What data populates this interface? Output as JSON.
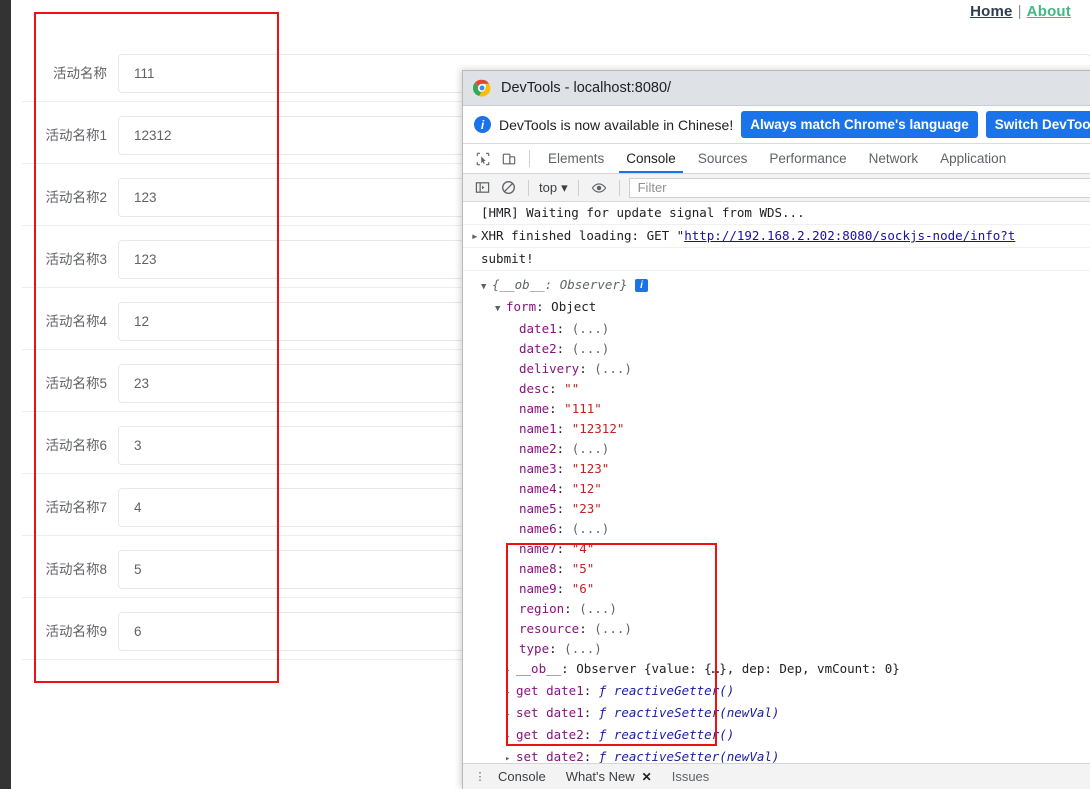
{
  "page": {
    "nav": {
      "home_label": "Home",
      "separator": "|",
      "about_label": "About"
    },
    "form": {
      "rows": [
        {
          "label": "活动名称",
          "value": "111"
        },
        {
          "label": "活动名称1",
          "value": "12312"
        },
        {
          "label": "活动名称2",
          "value": "123"
        },
        {
          "label": "活动名称3",
          "value": "123"
        },
        {
          "label": "活动名称4",
          "value": "12"
        },
        {
          "label": "活动名称5",
          "value": "23"
        },
        {
          "label": "活动名称6",
          "value": "3"
        },
        {
          "label": "活动名称7",
          "value": "4"
        },
        {
          "label": "活动名称8",
          "value": "5"
        },
        {
          "label": "活动名称9",
          "value": "6"
        }
      ]
    },
    "annotation_color": "#ee1111"
  },
  "devtools": {
    "titlebar": {
      "icon": "chrome-logo-icon",
      "title": "DevTools - localhost:8080/"
    },
    "banner": {
      "icon": "info-icon",
      "text": "DevTools is now available in Chinese!",
      "primary_button": "Always match Chrome's language",
      "secondary_button": "Switch DevToo"
    },
    "tabbar": {
      "inspect_icon": "inspect-element-icon",
      "device_icon": "device-toolbar-icon",
      "tabs": [
        {
          "label": "Elements",
          "active": false
        },
        {
          "label": "Console",
          "active": true
        },
        {
          "label": "Sources",
          "active": false
        },
        {
          "label": "Performance",
          "active": false
        },
        {
          "label": "Network",
          "active": false
        },
        {
          "label": "Application",
          "active": false
        }
      ]
    },
    "console_toolbar": {
      "sidebar_icon": "console-sidebar-icon",
      "clear_icon": "clear-console-icon",
      "context_label": "top",
      "context_caret": "▾",
      "eye_icon": "live-expression-eye-icon",
      "filter_placeholder": "Filter"
    },
    "console": {
      "messages": [
        {
          "type": "text",
          "text": "[HMR] Waiting for update signal from WDS..."
        },
        {
          "type": "link",
          "prefix": "XHR finished loading: GET \"",
          "link": "http://192.168.2.202:8080/sockjs-node/info?t",
          "arrow": "▸"
        },
        {
          "type": "text",
          "text": "submit!"
        }
      ],
      "object_tree": {
        "root": {
          "tri": "▼",
          "text": "{__ob__: Observer}",
          "badge": "i"
        },
        "form_node": {
          "tri": "▼",
          "key": "form",
          "value": "Object"
        },
        "props": [
          {
            "key": "date1",
            "value": "(...)",
            "kind": "dots"
          },
          {
            "key": "date2",
            "value": "(...)",
            "kind": "dots"
          },
          {
            "key": "delivery",
            "value": "(...)",
            "kind": "dots"
          },
          {
            "key": "desc",
            "value": "\"\"",
            "kind": "str"
          },
          {
            "key": "name",
            "value": "\"111\"",
            "kind": "str",
            "highlighted": true
          },
          {
            "key": "name1",
            "value": "\"12312\"",
            "kind": "str",
            "highlighted": true
          },
          {
            "key": "name2",
            "value": "(...)",
            "kind": "dots",
            "highlighted": true
          },
          {
            "key": "name3",
            "value": "\"123\"",
            "kind": "str",
            "highlighted": true
          },
          {
            "key": "name4",
            "value": "\"12\"",
            "kind": "str",
            "highlighted": true
          },
          {
            "key": "name5",
            "value": "\"23\"",
            "kind": "str",
            "highlighted": true
          },
          {
            "key": "name6",
            "value": "(...)",
            "kind": "dots",
            "highlighted": true
          },
          {
            "key": "name7",
            "value": "\"4\"",
            "kind": "str",
            "highlighted": true
          },
          {
            "key": "name8",
            "value": "\"5\"",
            "kind": "str",
            "highlighted": true
          },
          {
            "key": "name9",
            "value": "\"6\"",
            "kind": "str",
            "highlighted": true
          },
          {
            "key": "region",
            "value": "(...)",
            "kind": "dots"
          },
          {
            "key": "resource",
            "value": "(...)",
            "kind": "dots"
          },
          {
            "key": "type",
            "value": "(...)",
            "kind": "dots"
          }
        ],
        "ob_line": {
          "tri": "▸",
          "key": "__ob__",
          "value": "Observer {value: {…}, dep: Dep, vmCount: 0}",
          "vmcount": "0"
        },
        "accessors": [
          {
            "tri": "▸",
            "kind": "get",
            "key": "date1",
            "fn": "reactiveGetter()"
          },
          {
            "tri": "▸",
            "kind": "set",
            "key": "date1",
            "fn": "reactiveSetter(newVal)"
          },
          {
            "tri": "▸",
            "kind": "get",
            "key": "date2",
            "fn": "reactiveGetter()"
          },
          {
            "tri": "▸",
            "kind": "set",
            "key": "date2",
            "fn": "reactiveSetter(newVal)"
          }
        ]
      }
    },
    "drawer": {
      "menu_icon": "drawer-more-icon",
      "tabs": [
        {
          "label": "Console",
          "closable": false
        },
        {
          "label": "What's New",
          "closable": true
        },
        {
          "label": "Issues",
          "closable": false
        }
      ],
      "close_glyph": "✕"
    }
  }
}
